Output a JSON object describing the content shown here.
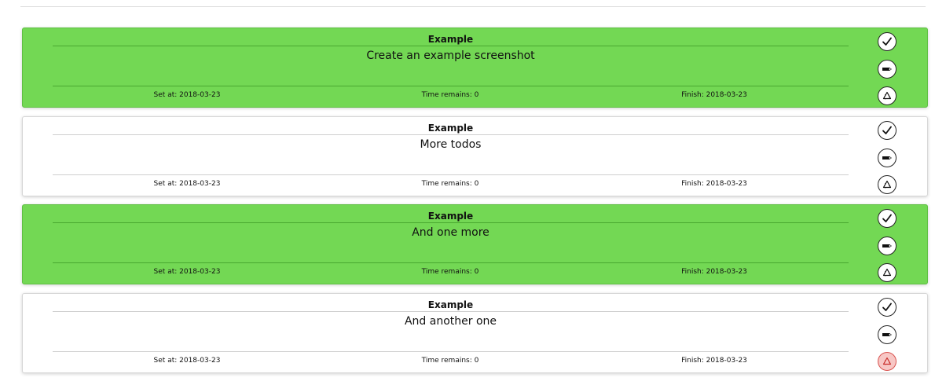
{
  "todos": [
    {
      "title": "Example",
      "description": "Create an example screenshot",
      "set_at": "Set at: 2018-03-23",
      "time_remains": "Time remains: 0",
      "finish": "Finish: 2018-03-23",
      "completed": true,
      "delete_highlighted": false
    },
    {
      "title": "Example",
      "description": "More todos",
      "set_at": "Set at: 2018-03-23",
      "time_remains": "Time remains: 0",
      "finish": "Finish: 2018-03-23",
      "completed": false,
      "delete_highlighted": false
    },
    {
      "title": "Example",
      "description": "And one more",
      "set_at": "Set at: 2018-03-23",
      "time_remains": "Time remains: 0",
      "finish": "Finish: 2018-03-23",
      "completed": true,
      "delete_highlighted": false
    },
    {
      "title": "Example",
      "description": "And another one",
      "set_at": "Set at: 2018-03-23",
      "time_remains": "Time remains: 0",
      "finish": "Finish: 2018-03-23",
      "completed": false,
      "delete_highlighted": true
    }
  ],
  "icons": {
    "complete": "checkmark-icon",
    "edit": "marker-icon",
    "delete": "recycle-icon"
  },
  "colors": {
    "completed_background": "#73d854",
    "delete_warning_background": "#f7c7c5",
    "delete_warning_border": "#d9534f"
  }
}
